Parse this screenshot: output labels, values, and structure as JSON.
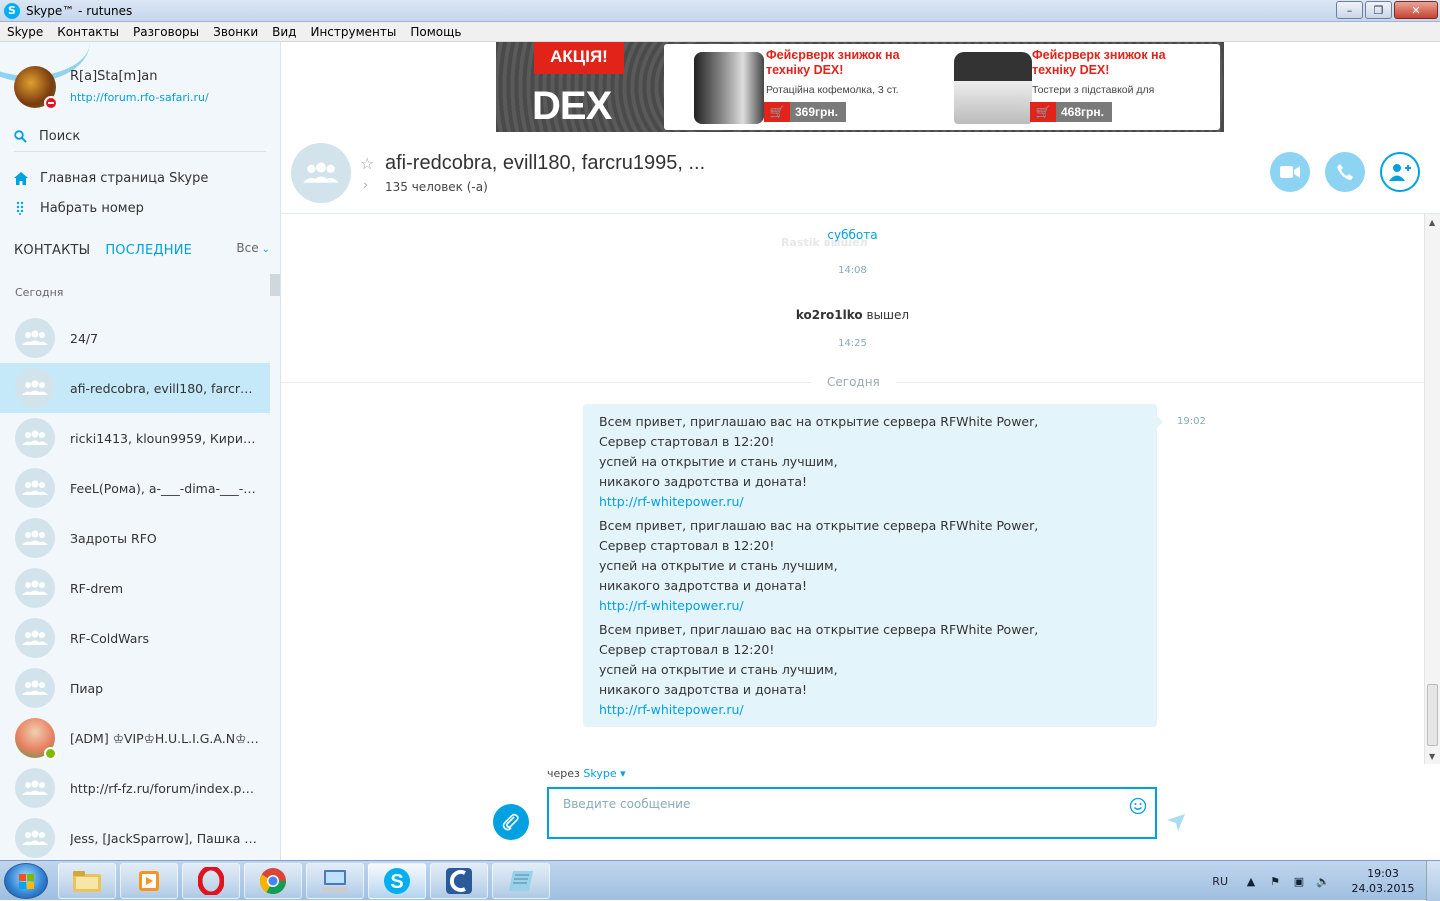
{
  "window": {
    "title": "Skype™ - rutunes"
  },
  "menu": [
    "Skype",
    "Контакты",
    "Разговоры",
    "Звонки",
    "Вид",
    "Инструменты",
    "Помощь"
  ],
  "profile": {
    "name": "R[a]Sta[m]an",
    "mood": "http://forum.rfo-safari.ru/",
    "status": "do-not-disturb"
  },
  "sidebar": {
    "search_label": "Поиск",
    "home_label": "Главная страница Skype",
    "dial_label": "Набрать номер",
    "tab_contacts": "КОНТАКТЫ",
    "tab_recent": "ПОСЛЕДНИЕ",
    "filter_label": "Все",
    "section_today": "Сегодня",
    "items": [
      {
        "name": "24/7",
        "type": "group"
      },
      {
        "name": "afi-redcobra, evill180, farcru1995, ...",
        "type": "group",
        "active": true
      },
      {
        "name": "ricki1413, kloun9959, Кирилл, ...",
        "type": "group"
      },
      {
        "name": "FeeL(Рома), a-___-dima-___-a, ...",
        "type": "group"
      },
      {
        "name": "Задроты RFO",
        "type": "group"
      },
      {
        "name": "RF-drem",
        "type": "group"
      },
      {
        "name": "RF-ColdWars",
        "type": "group"
      },
      {
        "name": "Пиар",
        "type": "group"
      },
      {
        "name": "[ADM] ♔VIP♔H.U.L.I.G.A.N♔VIP♔",
        "type": "user"
      },
      {
        "name": "http://rf-fz.ru/forum/index.php...",
        "type": "group"
      },
      {
        "name": "Jess, [JackSparrow], Пашка :*, ...",
        "type": "group"
      }
    ]
  },
  "ad": {
    "badge": "АКЦІЯ!",
    "brand": "DEX",
    "products": [
      {
        "title": "Фейєрверк знижок на техніку DEX!",
        "desc": "Ротаційна кофемолка, 3 ст.",
        "price": "369грн."
      },
      {
        "title": "Фейєрверк знижок на техніку DEX!",
        "desc": "Тостери з підставкой для",
        "price": "468грн."
      }
    ]
  },
  "conversation": {
    "title": "afi-redcobra, evill180, farcru1995, ...",
    "participants": "135 человек (-а)"
  },
  "chat": {
    "ghost_text": "Rastik вышел",
    "day_saturday": "суббота",
    "time_1": "14:08",
    "sys_user": "ko2ro1lko",
    "sys_action": "вышел",
    "time_2": "14:25",
    "day_today": "Сегодня",
    "bubble_time": "19:02",
    "messages": [
      {
        "lines": [
          "Всем привет, приглашаю вас на открытие сервера RFWhite Power,",
          "Сервер стартовал в 12:20!",
          "успей на открытие и стань лучшим,",
          "никакого задротства и доната!"
        ],
        "link": "http://rf-whitepower.ru/"
      },
      {
        "lines": [
          "Всем привет, приглашаю вас на открытие сервера RFWhite Power,",
          "Сервер стартовал в 12:20!",
          "успей на открытие и стань лучшим,",
          "никакого задротства и доната!"
        ],
        "link": "http://rf-whitepower.ru/"
      },
      {
        "lines": [
          "Всем привет, приглашаю вас на открытие сервера RFWhite Power,",
          "Сервер стартовал в 12:20!",
          "успей на открытие и стань лучшим,",
          "никакого задротства и доната!"
        ],
        "link": "http://rf-whitepower.ru/"
      }
    ]
  },
  "compose": {
    "via_prefix": "через",
    "via_service": "Skype",
    "placeholder": "Введите сообщение"
  },
  "taskbar": {
    "lang": "RU",
    "time": "19:03",
    "date": "24.03.2015"
  },
  "colors": {
    "accent": "#00a1e0",
    "active_item": "#c5e9f9",
    "bubble": "#e4f4fb"
  }
}
